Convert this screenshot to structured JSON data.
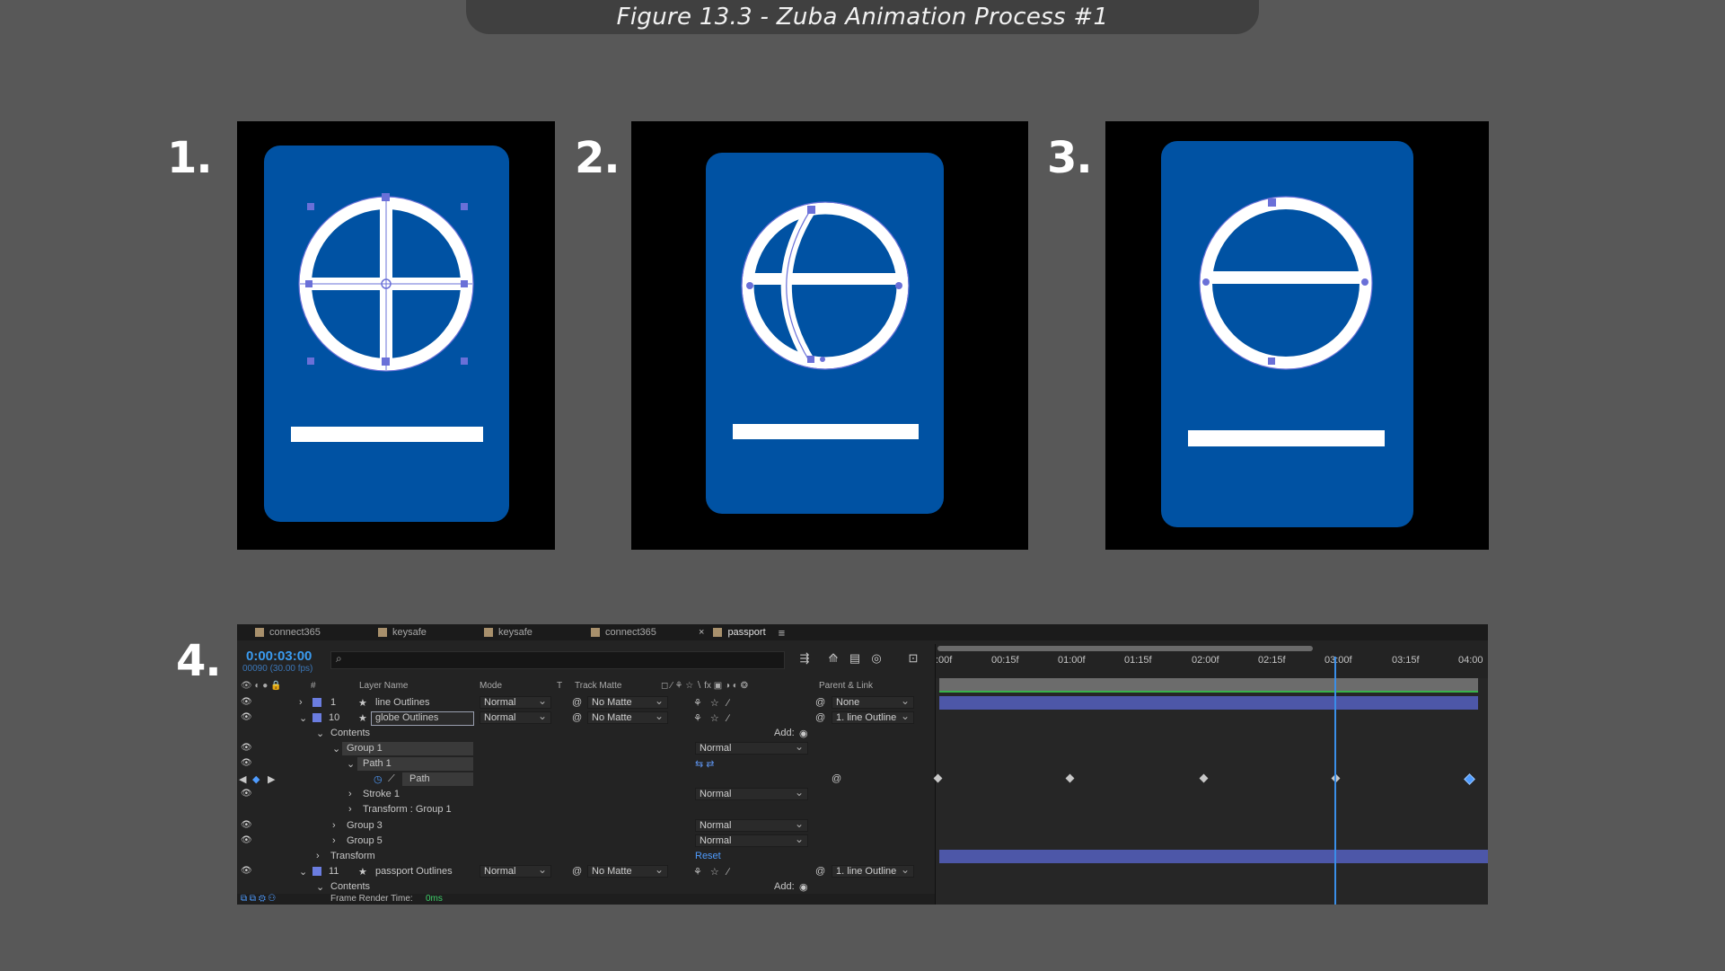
{
  "figure_title": "Figure 13.3 - Zuba Animation Process #1",
  "steps": [
    "1.",
    "2.",
    "3.",
    "4."
  ],
  "colors": {
    "background": "#585858",
    "passport_blue": "#0052a3",
    "panel_black": "#000000",
    "ae_accent": "#3a9bf0",
    "layer_label": "#6b7de0"
  },
  "ae": {
    "tabs": [
      {
        "label": "connect365",
        "active": false
      },
      {
        "label": "keysafe",
        "active": false
      },
      {
        "label": "keysafe",
        "active": false
      },
      {
        "label": "connect365",
        "active": false
      },
      {
        "label": "passport",
        "active": true
      }
    ],
    "timecode": "0:00:03:00",
    "fps": "00090 (30.00 fps)",
    "search_placeholder": "",
    "columns": {
      "num": "#",
      "layer_name": "Layer Name",
      "mode": "Mode",
      "t": "T",
      "track_matte": "Track Matte",
      "parent": "Parent & Link"
    },
    "ruler_labels": [
      ":00f",
      "00:15f",
      "01:00f",
      "01:15f",
      "02:00f",
      "02:15f",
      "03:00f",
      "03:15f",
      "04:00"
    ],
    "layers": {
      "l1": {
        "num": "1",
        "name": "line Outlines",
        "mode": "Normal",
        "matte": "No Matte",
        "parent": "None"
      },
      "l10": {
        "num": "10",
        "name": "globe Outlines",
        "mode": "Normal",
        "matte": "No Matte",
        "parent": "1. line Outline"
      },
      "l11": {
        "num": "11",
        "name": "passport Outlines",
        "mode": "Normal",
        "matte": "No Matte",
        "parent": "1. line Outline"
      }
    },
    "tree": {
      "contents": "Contents",
      "add": "Add:",
      "group1": "Group 1",
      "path1": "Path 1",
      "path": "Path",
      "stroke1": "Stroke 1",
      "transform_group1": "Transform : Group 1",
      "group3": "Group 3",
      "group5": "Group 5",
      "transform": "Transform",
      "reset": "Reset",
      "normal": "Normal",
      "contents2": "Contents",
      "add2": "Add:"
    },
    "footer_label": "Frame Render Time:",
    "footer_value": "0ms"
  }
}
